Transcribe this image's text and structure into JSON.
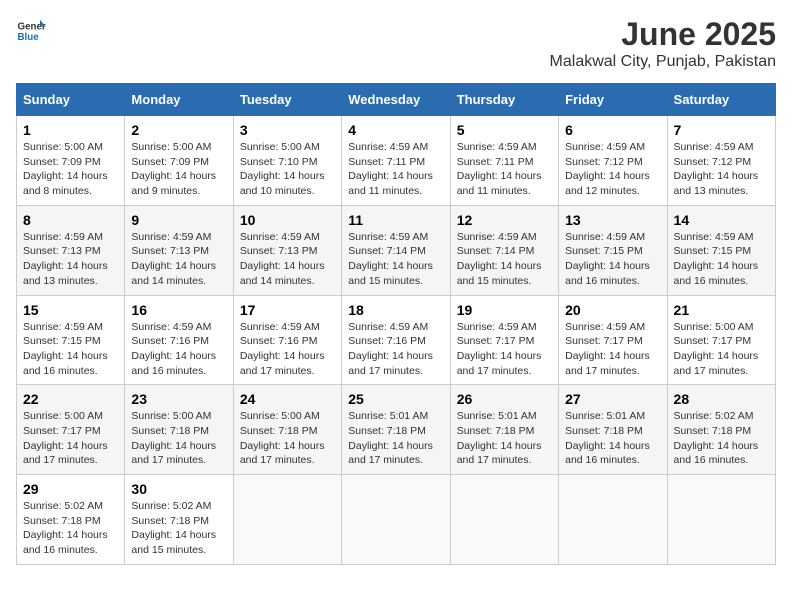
{
  "logo": {
    "general": "General",
    "blue": "Blue"
  },
  "title": "June 2025",
  "subtitle": "Malakwal City, Punjab, Pakistan",
  "headers": [
    "Sunday",
    "Monday",
    "Tuesday",
    "Wednesday",
    "Thursday",
    "Friday",
    "Saturday"
  ],
  "weeks": [
    [
      {
        "day": "1",
        "sunrise": "5:00 AM",
        "sunset": "7:09 PM",
        "daylight": "14 hours and 8 minutes."
      },
      {
        "day": "2",
        "sunrise": "5:00 AM",
        "sunset": "7:09 PM",
        "daylight": "14 hours and 9 minutes."
      },
      {
        "day": "3",
        "sunrise": "5:00 AM",
        "sunset": "7:10 PM",
        "daylight": "14 hours and 10 minutes."
      },
      {
        "day": "4",
        "sunrise": "4:59 AM",
        "sunset": "7:11 PM",
        "daylight": "14 hours and 11 minutes."
      },
      {
        "day": "5",
        "sunrise": "4:59 AM",
        "sunset": "7:11 PM",
        "daylight": "14 hours and 11 minutes."
      },
      {
        "day": "6",
        "sunrise": "4:59 AM",
        "sunset": "7:12 PM",
        "daylight": "14 hours and 12 minutes."
      },
      {
        "day": "7",
        "sunrise": "4:59 AM",
        "sunset": "7:12 PM",
        "daylight": "14 hours and 13 minutes."
      }
    ],
    [
      {
        "day": "8",
        "sunrise": "4:59 AM",
        "sunset": "7:13 PM",
        "daylight": "14 hours and 13 minutes."
      },
      {
        "day": "9",
        "sunrise": "4:59 AM",
        "sunset": "7:13 PM",
        "daylight": "14 hours and 14 minutes."
      },
      {
        "day": "10",
        "sunrise": "4:59 AM",
        "sunset": "7:13 PM",
        "daylight": "14 hours and 14 minutes."
      },
      {
        "day": "11",
        "sunrise": "4:59 AM",
        "sunset": "7:14 PM",
        "daylight": "14 hours and 15 minutes."
      },
      {
        "day": "12",
        "sunrise": "4:59 AM",
        "sunset": "7:14 PM",
        "daylight": "14 hours and 15 minutes."
      },
      {
        "day": "13",
        "sunrise": "4:59 AM",
        "sunset": "7:15 PM",
        "daylight": "14 hours and 16 minutes."
      },
      {
        "day": "14",
        "sunrise": "4:59 AM",
        "sunset": "7:15 PM",
        "daylight": "14 hours and 16 minutes."
      }
    ],
    [
      {
        "day": "15",
        "sunrise": "4:59 AM",
        "sunset": "7:15 PM",
        "daylight": "14 hours and 16 minutes."
      },
      {
        "day": "16",
        "sunrise": "4:59 AM",
        "sunset": "7:16 PM",
        "daylight": "14 hours and 16 minutes."
      },
      {
        "day": "17",
        "sunrise": "4:59 AM",
        "sunset": "7:16 PM",
        "daylight": "14 hours and 17 minutes."
      },
      {
        "day": "18",
        "sunrise": "4:59 AM",
        "sunset": "7:16 PM",
        "daylight": "14 hours and 17 minutes."
      },
      {
        "day": "19",
        "sunrise": "4:59 AM",
        "sunset": "7:17 PM",
        "daylight": "14 hours and 17 minutes."
      },
      {
        "day": "20",
        "sunrise": "4:59 AM",
        "sunset": "7:17 PM",
        "daylight": "14 hours and 17 minutes."
      },
      {
        "day": "21",
        "sunrise": "5:00 AM",
        "sunset": "7:17 PM",
        "daylight": "14 hours and 17 minutes."
      }
    ],
    [
      {
        "day": "22",
        "sunrise": "5:00 AM",
        "sunset": "7:17 PM",
        "daylight": "14 hours and 17 minutes."
      },
      {
        "day": "23",
        "sunrise": "5:00 AM",
        "sunset": "7:18 PM",
        "daylight": "14 hours and 17 minutes."
      },
      {
        "day": "24",
        "sunrise": "5:00 AM",
        "sunset": "7:18 PM",
        "daylight": "14 hours and 17 minutes."
      },
      {
        "day": "25",
        "sunrise": "5:01 AM",
        "sunset": "7:18 PM",
        "daylight": "14 hours and 17 minutes."
      },
      {
        "day": "26",
        "sunrise": "5:01 AM",
        "sunset": "7:18 PM",
        "daylight": "14 hours and 17 minutes."
      },
      {
        "day": "27",
        "sunrise": "5:01 AM",
        "sunset": "7:18 PM",
        "daylight": "14 hours and 16 minutes."
      },
      {
        "day": "28",
        "sunrise": "5:02 AM",
        "sunset": "7:18 PM",
        "daylight": "14 hours and 16 minutes."
      }
    ],
    [
      {
        "day": "29",
        "sunrise": "5:02 AM",
        "sunset": "7:18 PM",
        "daylight": "14 hours and 16 minutes."
      },
      {
        "day": "30",
        "sunrise": "5:02 AM",
        "sunset": "7:18 PM",
        "daylight": "14 hours and 15 minutes."
      },
      null,
      null,
      null,
      null,
      null
    ]
  ],
  "labels": {
    "sunrise": "Sunrise:",
    "sunset": "Sunset:",
    "daylight": "Daylight:"
  }
}
